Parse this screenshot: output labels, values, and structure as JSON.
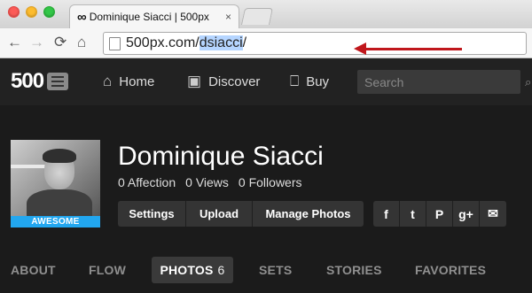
{
  "browser": {
    "tab": {
      "favicon": "∞",
      "title": "Dominique Siacci | 500px",
      "close": "×"
    },
    "nav": {
      "back": "←",
      "forward": "→",
      "reload": "⟳",
      "home": "⌂"
    },
    "address": {
      "prefix": "500px.com/",
      "highlight": "dsiacci",
      "suffix": "/"
    },
    "annotation_color": "#c0171c"
  },
  "site": {
    "logo": "500",
    "nav": {
      "home": "Home",
      "discover": "Discover",
      "buy": "Buy"
    },
    "search_placeholder": "Search"
  },
  "profile": {
    "badge": "AWESOME",
    "name": "Dominique Siacci",
    "stats": {
      "affection": "0 Affection",
      "views": "0 Views",
      "followers": "0 Followers"
    },
    "actions": {
      "settings": "Settings",
      "upload": "Upload",
      "manage": "Manage Photos"
    },
    "social": {
      "facebook": "f",
      "twitter": "t",
      "pinterest": "P",
      "googleplus": "g+",
      "email": "✉"
    },
    "tabs": {
      "about": "ABOUT",
      "flow": "FLOW",
      "photos": "PHOTOS",
      "photos_count": "6",
      "sets": "SETS",
      "stories": "STORIES",
      "favorites": "FAVORITES"
    }
  },
  "colors": {
    "accent_badge": "#22a7f0",
    "nav_bg": "#222222",
    "page_bg": "#1b1b1b"
  }
}
